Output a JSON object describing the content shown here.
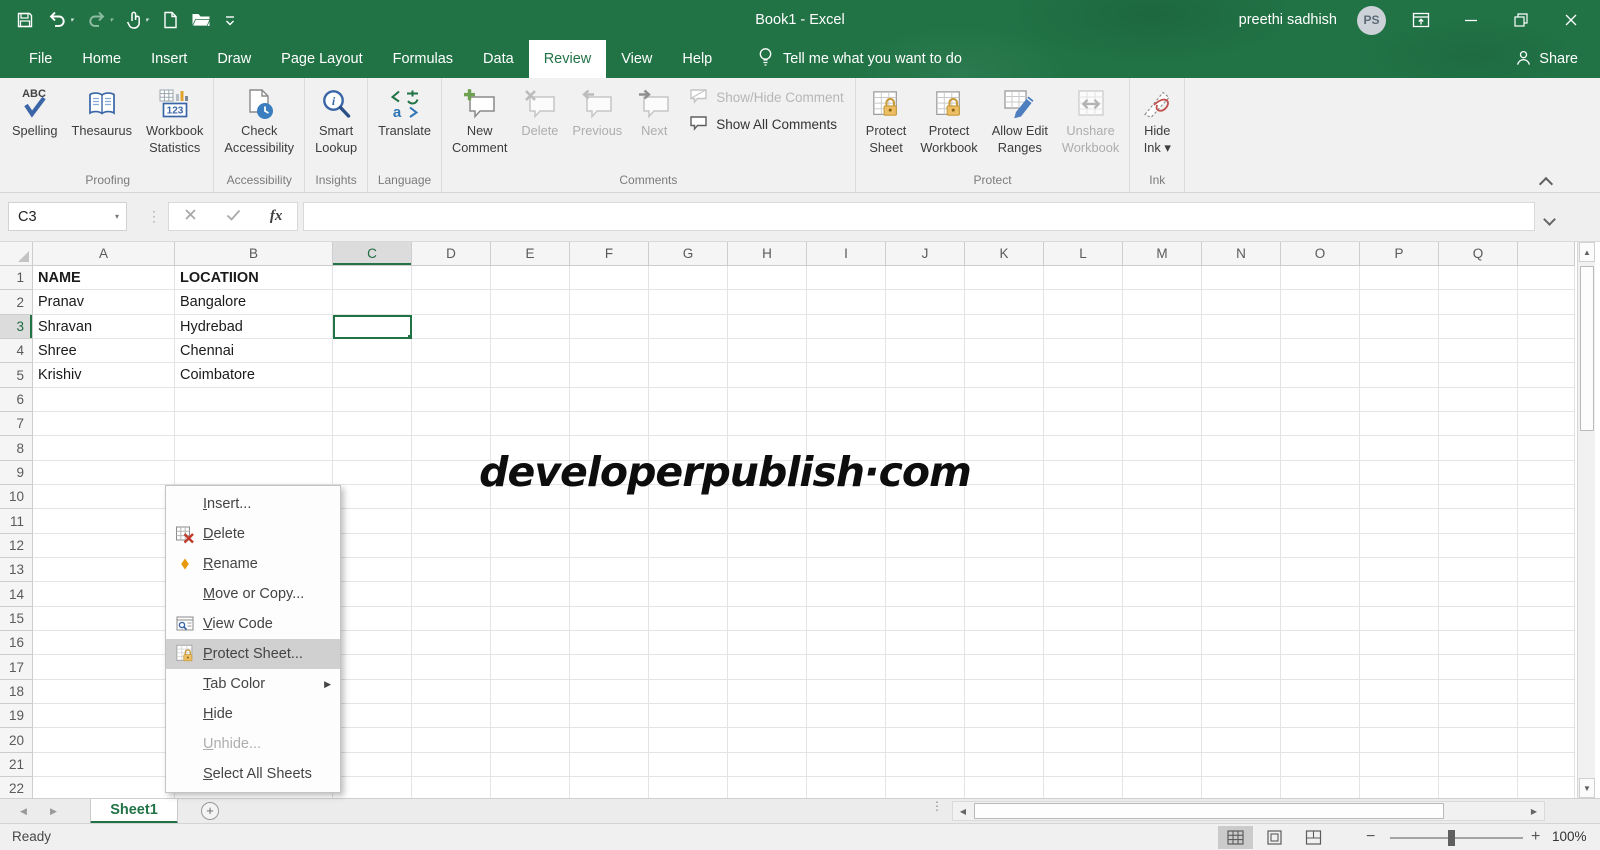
{
  "titlebar": {
    "title": "Book1 - Excel",
    "user_name": "preethi sadhish",
    "avatar_initials": "PS"
  },
  "ribbon_tabs": [
    {
      "id": "file",
      "label": "File",
      "active": false
    },
    {
      "id": "home",
      "label": "Home",
      "active": false
    },
    {
      "id": "insert",
      "label": "Insert",
      "active": false
    },
    {
      "id": "draw",
      "label": "Draw",
      "active": false
    },
    {
      "id": "page-layout",
      "label": "Page Layout",
      "active": false
    },
    {
      "id": "formulas",
      "label": "Formulas",
      "active": false
    },
    {
      "id": "data",
      "label": "Data",
      "active": false
    },
    {
      "id": "review",
      "label": "Review",
      "active": true
    },
    {
      "id": "view",
      "label": "View",
      "active": false
    },
    {
      "id": "help",
      "label": "Help",
      "active": false
    }
  ],
  "tellme_label": "Tell me what you want to do",
  "share_label": "Share",
  "ribbon": {
    "groups": [
      {
        "name": "proofing",
        "label": "Proofing",
        "buttons": [
          {
            "id": "spelling",
            "label": "Spelling"
          },
          {
            "id": "thesaurus",
            "label": "Thesaurus"
          },
          {
            "id": "workbook-statistics",
            "label": "Workbook\nStatistics"
          }
        ]
      },
      {
        "name": "accessibility",
        "label": "Accessibility",
        "buttons": [
          {
            "id": "check-accessibility",
            "label": "Check\nAccessibility"
          }
        ]
      },
      {
        "name": "insights",
        "label": "Insights",
        "buttons": [
          {
            "id": "smart-lookup",
            "label": "Smart\nLookup"
          }
        ]
      },
      {
        "name": "language",
        "label": "Language",
        "buttons": [
          {
            "id": "translate",
            "label": "Translate"
          }
        ]
      },
      {
        "name": "comments",
        "label": "Comments",
        "buttons": [
          {
            "id": "new-comment",
            "label": "New\nComment"
          },
          {
            "id": "delete-comment",
            "label": "Delete",
            "disabled": true
          },
          {
            "id": "previous-comment",
            "label": "Previous",
            "disabled": true
          },
          {
            "id": "next-comment",
            "label": "Next",
            "disabled": true
          }
        ],
        "small_buttons": [
          {
            "id": "show-hide-comment",
            "label": "Show/Hide Comment",
            "disabled": true
          },
          {
            "id": "show-all-comments",
            "label": "Show All Comments",
            "disabled": false
          }
        ]
      },
      {
        "name": "protect",
        "label": "Protect",
        "buttons": [
          {
            "id": "protect-sheet",
            "label": "Protect\nSheet"
          },
          {
            "id": "protect-workbook",
            "label": "Protect\nWorkbook"
          },
          {
            "id": "allow-edit-ranges",
            "label": "Allow Edit\nRanges"
          },
          {
            "id": "unshare-workbook",
            "label": "Unshare\nWorkbook",
            "disabled": true
          }
        ]
      },
      {
        "name": "ink",
        "label": "Ink",
        "buttons": [
          {
            "id": "hide-ink",
            "label": "Hide\nInk ▾"
          }
        ]
      }
    ]
  },
  "formula_bar": {
    "name_box": "C3",
    "formula_value": ""
  },
  "grid": {
    "columns": [
      "A",
      "B",
      "C",
      "D",
      "E",
      "F",
      "G",
      "H",
      "I",
      "J",
      "K",
      "L",
      "M",
      "N",
      "O",
      "P",
      "Q"
    ],
    "row_count": 22,
    "selection": {
      "cell": "C3",
      "column": "C",
      "row": 3
    },
    "cells": [
      {
        "ref": "A1",
        "value": "NAME",
        "bold": true
      },
      {
        "ref": "B1",
        "value": "LOCATIION",
        "bold": true
      },
      {
        "ref": "A2",
        "value": "Pranav"
      },
      {
        "ref": "B2",
        "value": "Bangalore"
      },
      {
        "ref": "A3",
        "value": "Shravan"
      },
      {
        "ref": "B3",
        "value": "Hydrebad"
      },
      {
        "ref": "A4",
        "value": "Shree"
      },
      {
        "ref": "B4",
        "value": "Chennai"
      },
      {
        "ref": "A5",
        "value": "Krishiv"
      },
      {
        "ref": "B5",
        "value": "Coimbatore"
      }
    ],
    "watermark": "developerpublish·com"
  },
  "context_menu": {
    "items": [
      {
        "label": "Insert...",
        "icon": null
      },
      {
        "label": "Delete",
        "icon": "delete-sheet-icon"
      },
      {
        "label": "Rename",
        "icon": "rename-icon"
      },
      {
        "label": "Move or Copy...",
        "icon": null
      },
      {
        "label": "View Code",
        "icon": "view-code-icon"
      },
      {
        "label": "Protect Sheet...",
        "icon": "protect-sheet-menu-icon",
        "highlighted": true
      },
      {
        "label": "Tab Color",
        "icon": null,
        "submenu": true
      },
      {
        "label": "Hide",
        "icon": null
      },
      {
        "label": "Unhide...",
        "icon": null,
        "disabled": true
      },
      {
        "label": "Select All Sheets",
        "icon": null
      }
    ]
  },
  "sheet_bar": {
    "active_tab": "Sheet1"
  },
  "status_bar": {
    "mode": "Ready",
    "zoom_level": "100%"
  },
  "icons": {
    "dropdown": "▾",
    "submenu_arrow": "▶",
    "scroll_left": "◀",
    "scroll_right": "▶",
    "scroll_up": "▲",
    "scroll_down": "▼",
    "add_sheet": "+",
    "zoom_in": "+",
    "zoom_out": "−",
    "tab_dots": "⋮",
    "fx": "fx"
  },
  "colors": {
    "accent_green": "#217346",
    "disabled_text": "#adadad",
    "selection_border": "#217346"
  }
}
